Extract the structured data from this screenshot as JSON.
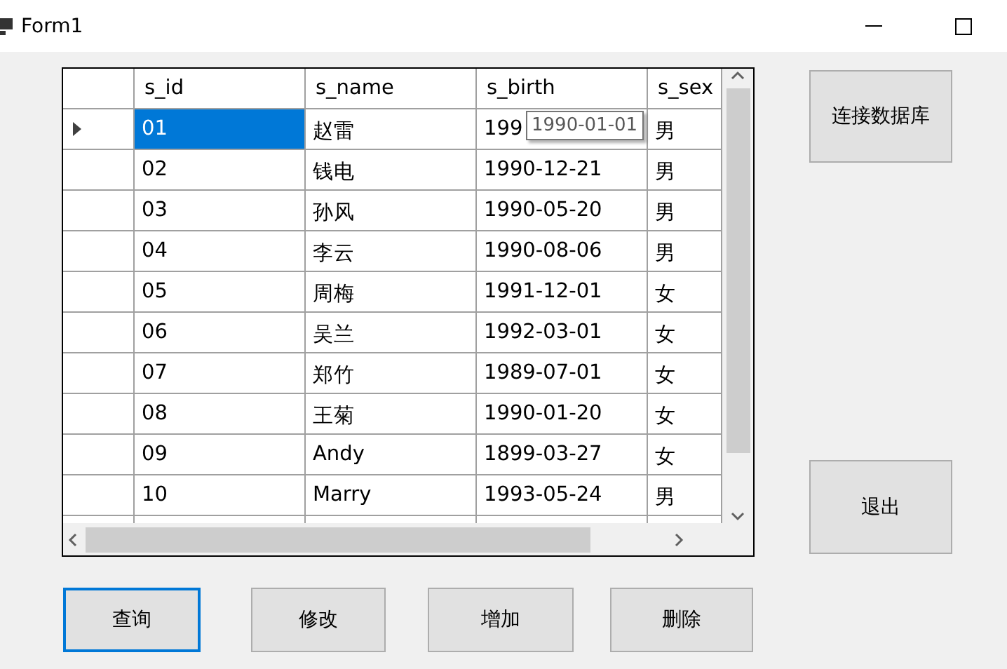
{
  "window": {
    "title": "Form1"
  },
  "grid": {
    "columns": [
      "s_id",
      "s_name",
      "s_birth",
      "s_sex"
    ],
    "rows": [
      {
        "selected": true,
        "cells": [
          "01",
          "赵雷",
          "199",
          "男"
        ]
      },
      {
        "selected": false,
        "cells": [
          "02",
          "钱电",
          "1990-12-21",
          "男"
        ]
      },
      {
        "selected": false,
        "cells": [
          "03",
          "孙风",
          "1990-05-20",
          "男"
        ]
      },
      {
        "selected": false,
        "cells": [
          "04",
          "李云",
          "1990-08-06",
          "男"
        ]
      },
      {
        "selected": false,
        "cells": [
          "05",
          "周梅",
          "1991-12-01",
          "女"
        ]
      },
      {
        "selected": false,
        "cells": [
          "06",
          "吴兰",
          "1992-03-01",
          "女"
        ]
      },
      {
        "selected": false,
        "cells": [
          "07",
          "郑竹",
          "1989-07-01",
          "女"
        ]
      },
      {
        "selected": false,
        "cells": [
          "08",
          "王菊",
          "1990-01-20",
          "女"
        ]
      },
      {
        "selected": false,
        "cells": [
          "09",
          "Andy",
          "1899-03-27",
          "女"
        ]
      },
      {
        "selected": false,
        "cells": [
          "10",
          "Marry",
          "1993-05-24",
          "男"
        ]
      }
    ],
    "tooltip": "1990-01-01"
  },
  "side_buttons": [
    {
      "label": "连接数据库",
      "focused": false
    },
    {
      "label": "退出",
      "focused": false
    }
  ],
  "bottom_buttons": [
    {
      "label": "查询",
      "focused": true
    },
    {
      "label": "修改",
      "focused": false
    },
    {
      "label": "增加",
      "focused": false
    },
    {
      "label": "删除",
      "focused": false
    }
  ]
}
